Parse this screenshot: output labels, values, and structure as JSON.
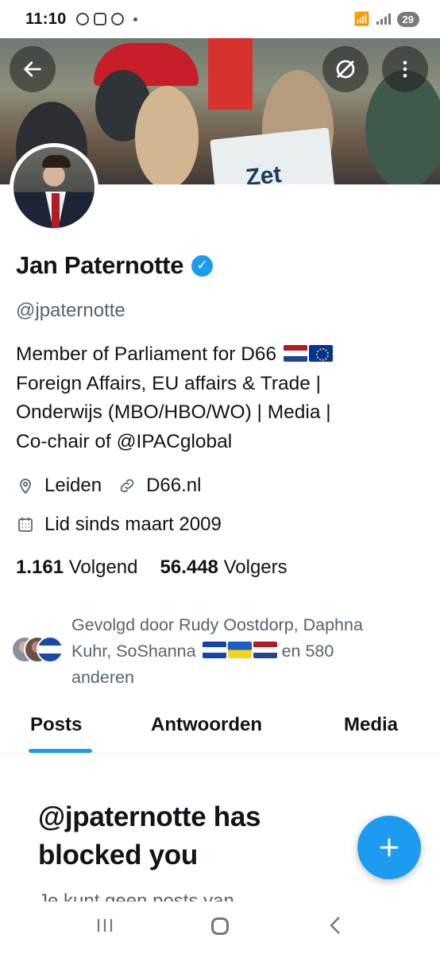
{
  "status_bar": {
    "time": "11:10",
    "battery": "29"
  },
  "header": {
    "back_icon": "arrow-left-icon",
    "mute_icon": "mute-icon",
    "more_icon": "more-vertical-icon"
  },
  "profile": {
    "name": "Jan Paternotte",
    "verified_icon": "verified-badge-icon",
    "handle": "@jpaternotte",
    "bio_lines": [
      "Member of Parliament for D66",
      "Foreign Affairs, EU affairs & Trade |",
      "Onderwijs (MBO/HBO/WO) | Media |",
      "Co-chair of @IPACglobal"
    ],
    "location": "Leiden",
    "website": "D66.nl",
    "joined": "Lid sinds maart 2009",
    "following_count": "1.161",
    "following_label": "Volgend",
    "followers_count": "56.448",
    "followers_label": "Volgers",
    "followed_by_line1": "Gevolgd door Rudy Oostdorp, Daphna",
    "followed_by_line2a": "Kuhr, SoShanna",
    "followed_by_line2b": "en 580",
    "followed_by_line3": "anderen"
  },
  "tabs": [
    {
      "label": "Posts",
      "active": true
    },
    {
      "label": "Antwoorden",
      "active": false
    },
    {
      "label": "Media",
      "active": false
    }
  ],
  "blocked": {
    "title": "@jpaternotte has blocked you",
    "subtitle": "Je kunt geen posts van"
  },
  "fab": {
    "icon": "plus-icon"
  },
  "colors": {
    "accent": "#1d9bf0",
    "text": "#0f1419",
    "secondary": "#536471"
  }
}
